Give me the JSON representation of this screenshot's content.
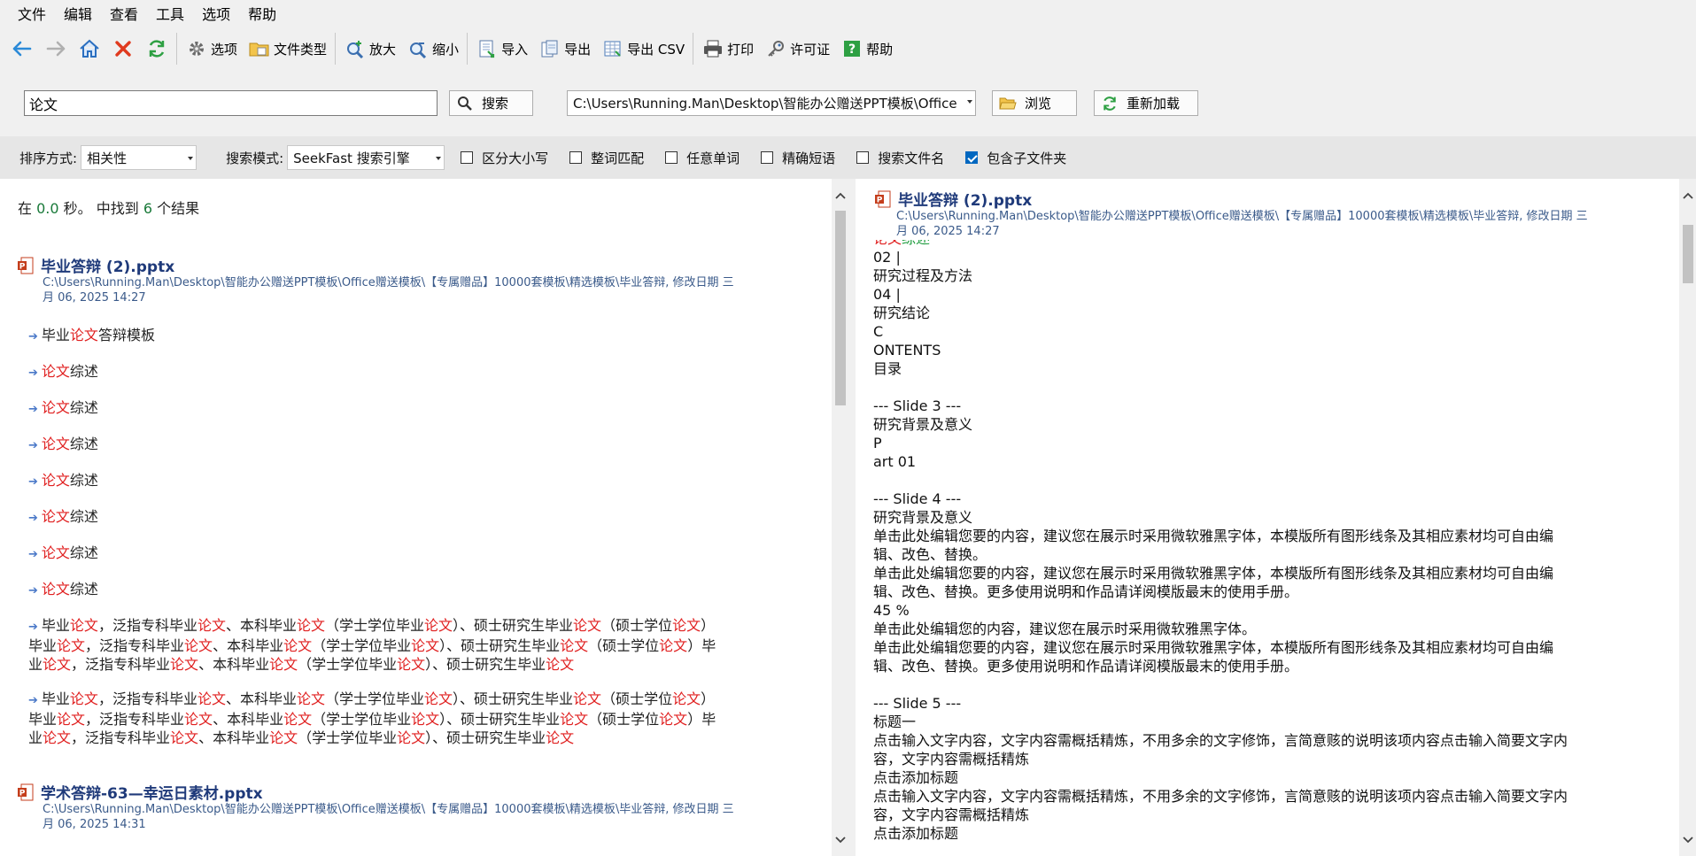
{
  "menu": [
    "文件",
    "编辑",
    "查看",
    "工具",
    "选项",
    "帮助"
  ],
  "toolbar": {
    "options": "选项",
    "file_types": "文件类型",
    "zoom_in": "放大",
    "zoom_out": "缩小",
    "import": "导入",
    "export": "导出",
    "export_csv": "导出 CSV",
    "print": "打印",
    "license": "许可证",
    "help": "帮助"
  },
  "search": {
    "query": "论文",
    "search_button": "搜索",
    "path": "C:\\Users\\Running.Man\\Desktop\\智能办公赠送PPT模板\\Office",
    "browse_button": "浏览",
    "reload_button": "重新加载"
  },
  "options": {
    "sort_label": "排序方式:",
    "sort_value": "相关性",
    "mode_label": "搜索模式:",
    "mode_value": "SeekFast 搜索引擎",
    "checkboxes": [
      {
        "label": "区分大小写",
        "checked": false
      },
      {
        "label": "整词匹配",
        "checked": false
      },
      {
        "label": "任意单词",
        "checked": false
      },
      {
        "label": "精确短语",
        "checked": false
      },
      {
        "label": "搜索文件名",
        "checked": false
      },
      {
        "label": "包含子文件夹",
        "checked": true
      }
    ]
  },
  "summary": {
    "prefix": "在",
    "time": "0.0",
    "middle": "秒。 中找到",
    "count": "6",
    "suffix": "个结果"
  },
  "results": [
    {
      "title": "毕业答辩 (2).pptx",
      "path_line1": "C:\\Users\\Running.Man\\Desktop\\智能办公赠送PPT模板\\Office赠送模板\\【专属赠品】10000套模板\\精选模板\\毕业答辩, 修改日期 三",
      "path_line2": "月 06, 2025 14:27"
    },
    {
      "title": "学术答辩-63—幸运日素材.pptx",
      "path_line1": "C:\\Users\\Running.Man\\Desktop\\智能办公赠送PPT模板\\Office赠送模板\\【专属赠品】10000套模板\\精选模板\\毕业答辩, 修改日期 三",
      "path_line2": "月 06, 2025 14:31"
    }
  ],
  "snippet_texts": {
    "term": "论文",
    "s1_pre": "毕业",
    "s1_post": "答辩模板",
    "review": "综述",
    "p_a": "毕业",
    "p_b": "，泛指专科毕业",
    "p_c": "、本科毕业",
    "p_d": "（学士学位毕业",
    "p_e": "）、硕士研究生毕业",
    "p_f": "（硕士学位",
    "p_g": "）",
    "p_h": "毕业",
    "p_i": "（硕士学位",
    "p_j": "）毕",
    "p_k": "业"
  },
  "preview": {
    "title": "毕业答辩 (2).pptx",
    "path_line1": "C:\\Users\\Running.Man\\Desktop\\智能办公赠送PPT模板\\Office赠送模板\\【专属赠品】10000套模板\\精选模板\\毕业答辩, 修改日期 三",
    "path_line2": "月 06, 2025 14:27",
    "cut_line_a": "论文",
    "cut_line_b": "综述",
    "lines": [
      "02 |",
      "研究过程及方法",
      "04 |",
      "研究结论",
      "C",
      "ONTENTS",
      "目录",
      "",
      "--- Slide 3 ---",
      "研究背景及意义",
      "P",
      "art 01",
      "",
      "--- Slide 4 ---",
      "研究背景及意义",
      "单击此处编辑您要的内容，建议您在展示时采用微软雅黑字体，本模版所有图形线条及其相应素材均可自由编",
      "辑、改色、替换。",
      "单击此处编辑您要的内容，建议您在展示时采用微软雅黑字体，本模版所有图形线条及其相应素材均可自由编",
      "辑、改色、替换。更多使用说明和作品请详阅模版最末的使用手册。",
      "45 %",
      "单击此处编辑您的内容，建议您在展示时采用微软雅黑字体。",
      "单击此处编辑您要的内容，建议您在展示时采用微软雅黑字体，本模版所有图形线条及其相应素材均可自由编",
      "辑、改色、替换。更多使用说明和作品请详阅模版最末的使用手册。",
      "",
      "--- Slide 5 ---",
      "标题一",
      "点击输入文字内容，文字内容需概括精炼，不用多余的文字修饰，言简意赅的说明该项内容点击输入简要文字内",
      "容，文字内容需概括精炼",
      "点击添加标题",
      "点击输入文字内容，文字内容需概括精炼，不用多余的文字修饰，言简意赅的说明该项内容点击输入简要文字内",
      "容，文字内容需概括精炼",
      "点击添加标题"
    ]
  },
  "colors": {
    "highlight": "#e02020",
    "title": "#1f3a7a",
    "count": "#1a7a3a"
  }
}
